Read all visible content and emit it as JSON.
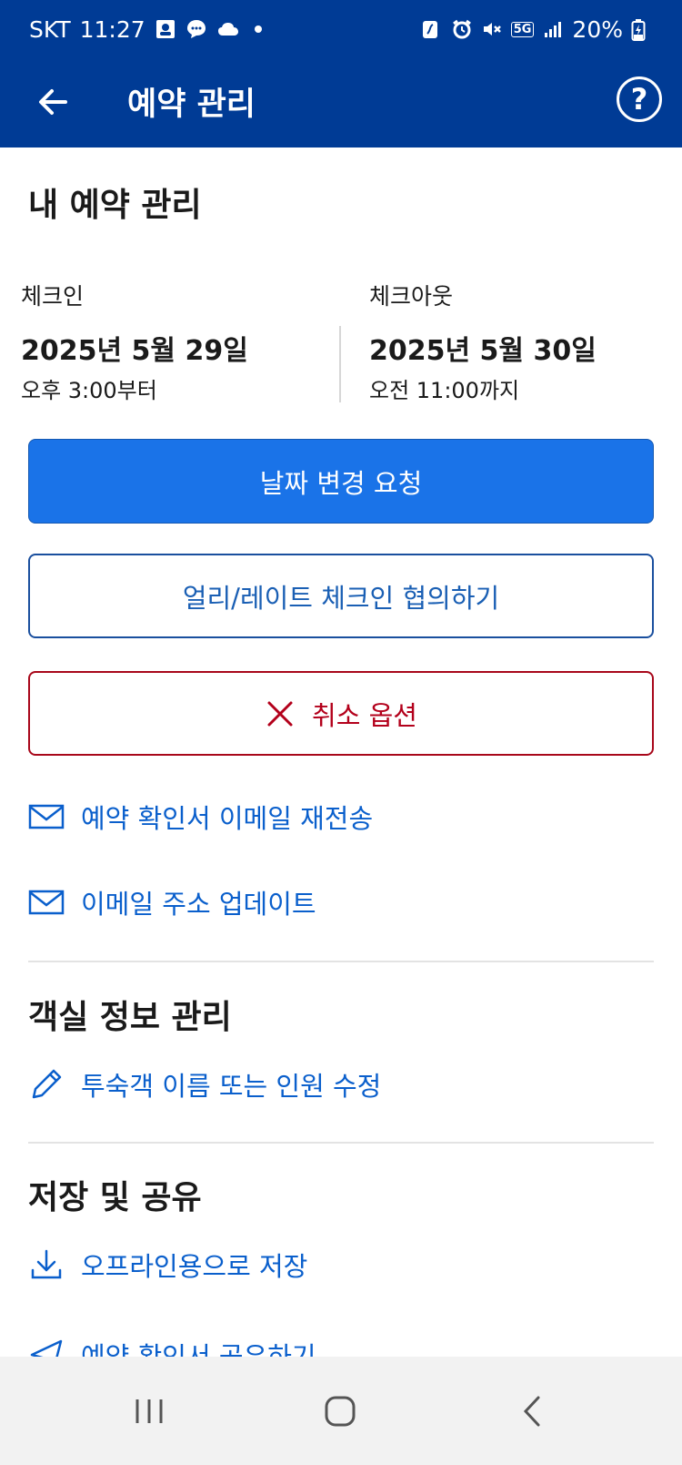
{
  "status_bar": {
    "carrier": "SKT",
    "time": "11:27",
    "battery": "20%",
    "network": "5G"
  },
  "header": {
    "title": "예약 관리"
  },
  "reservation": {
    "section_title": "내 예약 관리",
    "checkin": {
      "label": "체크인",
      "date": "2025년 5월 29일",
      "time": "오후 3:00부터"
    },
    "checkout": {
      "label": "체크아웃",
      "date": "2025년 5월 30일",
      "time": "오전 11:00까지"
    },
    "buttons": {
      "change_dates": "날짜 변경 요청",
      "early_late": "얼리/레이트 체크인 협의하기",
      "cancel_options": "취소 옵션"
    },
    "links": {
      "resend_email": "예약 확인서 이메일 재전송",
      "update_email": "이메일 주소 업데이트"
    }
  },
  "room_info": {
    "section_title": "객실 정보 관리",
    "edit_guest": "투숙객 이름 또는 인원 수정"
  },
  "save_share": {
    "section_title": "저장 및 공유",
    "save_offline": "오프라인용으로 저장",
    "share_confirmation": "예약 확인서 공유하기"
  },
  "colors": {
    "header_bg": "#003b95",
    "primary_button": "#1a73e8",
    "link": "#0a5fcc",
    "danger": "#b3001b"
  }
}
